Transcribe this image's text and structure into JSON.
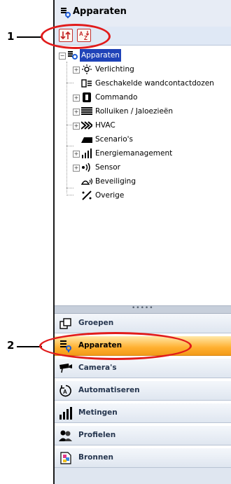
{
  "header": {
    "title": "Apparaten"
  },
  "toolbar": {
    "buttons": [
      {
        "name": "sort-order"
      },
      {
        "name": "sort-alphabetical",
        "text": "A Z"
      }
    ]
  },
  "tree": {
    "root": "Apparaten",
    "items": [
      {
        "label": "Verlichting",
        "expandable": true,
        "expander": "+"
      },
      {
        "label": "Geschakelde wandcontactdozen",
        "expandable": false
      },
      {
        "label": "Commando",
        "expandable": true,
        "expander": "+"
      },
      {
        "label": "Rolluiken / Jaloezieën",
        "expandable": true,
        "expander": "+"
      },
      {
        "label": "HVAC",
        "expandable": true,
        "expander": "+"
      },
      {
        "label": "Scenario's",
        "expandable": false
      },
      {
        "label": "Energiemanagement",
        "expandable": true,
        "expander": "+"
      },
      {
        "label": "Sensor",
        "expandable": true,
        "expander": "+"
      },
      {
        "label": "Beveiliging",
        "expandable": false
      },
      {
        "label": "Overige",
        "expandable": false
      }
    ],
    "root_expander": "−"
  },
  "nav": [
    {
      "label": "Groepen",
      "icon": "groups-icon",
      "active": false
    },
    {
      "label": "Apparaten",
      "icon": "devices-icon",
      "active": true
    },
    {
      "label": "Camera's",
      "icon": "camera-icon",
      "active": false
    },
    {
      "label": "Automatiseren",
      "icon": "automation-icon",
      "active": false
    },
    {
      "label": "Metingen",
      "icon": "measurements-icon",
      "active": false
    },
    {
      "label": "Profielen",
      "icon": "profiles-icon",
      "active": false
    },
    {
      "label": "Bronnen",
      "icon": "sources-icon",
      "active": false
    }
  ],
  "splitter": {
    "grip": "•••••"
  },
  "callouts": [
    {
      "number": "1"
    },
    {
      "number": "2"
    }
  ],
  "colors": {
    "selection": "#1f43b8",
    "active_nav": "#ffb030",
    "callout_oval": "#e11b1b"
  }
}
